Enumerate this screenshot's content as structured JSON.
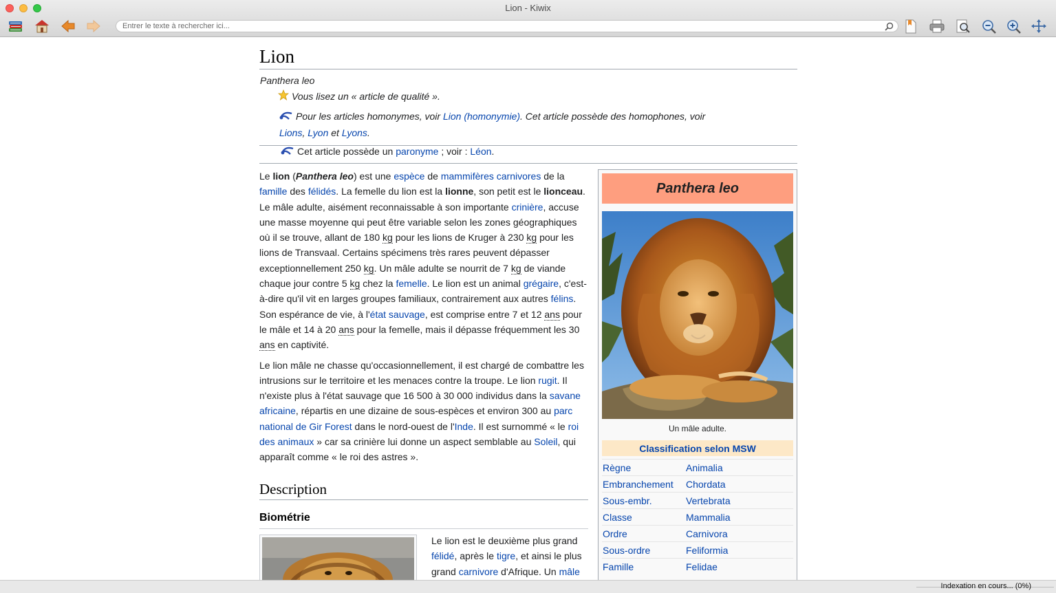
{
  "window": {
    "title": "Lion - Kiwix"
  },
  "toolbar": {
    "icons": [
      "library-icon",
      "home-icon",
      "back-arrow-icon",
      "forward-arrow-icon",
      "bookmark-icon",
      "print-icon",
      "find-in-page-icon",
      "zoom-out-icon",
      "zoom-in-icon",
      "fullscreen-icon"
    ],
    "search_placeholder": "Entrer le texte à rechercher ici..."
  },
  "article": {
    "title": "Lion",
    "subtitle": "Panthera leo",
    "hatnote_quality": "Vous lisez un « article de qualité ».",
    "hatnote_homonymie": {
      "prefix": "Pour les articles homonymes, voir ",
      "link1": "Lion (homonymie)",
      "middle": ". Cet article possède des homophones, voir",
      "link2": "Lions",
      "sep1": ", ",
      "link3": "Lyon",
      "sep2": " et ",
      "link4": "Lyons",
      "end": "."
    },
    "hatnote_paronyme": {
      "prefix": "Cet article possède un ",
      "link1": "paronyme",
      "middle": " ; voir : ",
      "link2": "Léon",
      "end": "."
    },
    "paragraph1": [
      {
        "t": "Le "
      },
      {
        "b": "lion"
      },
      {
        "t": " ("
      },
      {
        "bi": "Panthera leo"
      },
      {
        "t": ") est une "
      },
      {
        "a": "espèce"
      },
      {
        "t": " de "
      },
      {
        "a": "mammifères carnivores"
      },
      {
        "t": " de la "
      },
      {
        "a": "famille"
      },
      {
        "t": " des "
      },
      {
        "a": "félidés"
      },
      {
        "t": ". La femelle du lion est la "
      },
      {
        "b": "lionne"
      },
      {
        "t": ", son petit est le "
      },
      {
        "b": "lionceau"
      },
      {
        "t": ". "
      },
      {
        "t": "Le mâle adulte, aisément reconnaissable à son importante "
      },
      {
        "a": "crinière"
      },
      {
        "t": ", accuse une masse moyenne qui peut être variable selon les zones géographiques où il se trouve, allant de 180 "
      },
      {
        "u": "kg"
      },
      {
        "t": " pour les lions de Kruger à 230 "
      },
      {
        "u": "kg"
      },
      {
        "t": " pour les lions de Transvaal. Certains spécimens très rares peuvent dépasser exceptionnellement 250 "
      },
      {
        "u": "kg"
      },
      {
        "t": ". Un mâle adulte se nourrit de 7 "
      },
      {
        "u": "kg"
      },
      {
        "t": " de viande chaque jour contre 5 "
      },
      {
        "u": "kg"
      },
      {
        "t": " chez la "
      },
      {
        "a": "femelle"
      },
      {
        "t": ". Le lion est un animal "
      },
      {
        "a": "grégaire"
      },
      {
        "t": ", c'est-à-dire qu'il vit en larges groupes familiaux, contrairement aux autres "
      },
      {
        "a": "félins"
      },
      {
        "t": ". Son espérance de vie, à l'"
      },
      {
        "a": "état sauvage"
      },
      {
        "t": ", est comprise entre 7 et 12 "
      },
      {
        "u": "ans"
      },
      {
        "t": " pour le mâle et 14 à 20 "
      },
      {
        "u": "ans"
      },
      {
        "t": " pour la femelle, mais il dépasse fréquemment les 30 "
      },
      {
        "u": "ans"
      },
      {
        "t": " en captivité."
      }
    ],
    "paragraph2": [
      {
        "t": "Le lion mâle ne chasse qu'occasionnellement, il est chargé de combattre les intrusions sur le territoire et les menaces contre la troupe. Le lion "
      },
      {
        "a": "rugit"
      },
      {
        "t": ". Il n'existe plus à l'état sauvage que 16 500 à 30 000 individus dans la "
      },
      {
        "a": "savane africaine"
      },
      {
        "t": ", répartis en une dizaine de sous-espèces et environ 300 au "
      },
      {
        "a": "parc national de Gir Forest"
      },
      {
        "t": " dans le nord-ouest de l'"
      },
      {
        "a": "Inde"
      },
      {
        "t": ". Il est surnommé « le "
      },
      {
        "a": "roi des animaux"
      },
      {
        "t": " » car sa crinière lui donne un aspect semblable au "
      },
      {
        "a": "Soleil"
      },
      {
        "t": ", qui apparaît comme « le roi des astres »."
      }
    ],
    "section_description": "Description",
    "subsection_biometrie": "Biométrie",
    "paragraph3": [
      {
        "t": "Le lion est le deuxième plus grand "
      },
      {
        "a": "félidé"
      },
      {
        "t": ", après le "
      },
      {
        "a": "tigre"
      },
      {
        "t": ", et ainsi le plus grand "
      },
      {
        "a": "carnivore"
      },
      {
        "t": " d'Afrique. Un "
      },
      {
        "a": "mâle"
      }
    ]
  },
  "infobox": {
    "title": "Panthera leo",
    "caption": "Un mâle adulte.",
    "classification_header": "Classification selon MSW",
    "rows": [
      {
        "rank": "Règne",
        "value": "Animalia"
      },
      {
        "rank": "Embranchement",
        "value": "Chordata"
      },
      {
        "rank": "Sous-embr.",
        "value": "Vertebrata"
      },
      {
        "rank": "Classe",
        "value": "Mammalia"
      },
      {
        "rank": "Ordre",
        "value": "Carnivora"
      },
      {
        "rank": "Sous-ordre",
        "value": "Feliformia"
      },
      {
        "rank": "Famille",
        "value": "Felidae"
      }
    ],
    "colors": {
      "title_bg": "#fe9e7f",
      "class_bg": "#fde8c7",
      "link": "#0645ad"
    }
  },
  "statusbar": {
    "text": "Indexation en cours... (0%)"
  }
}
